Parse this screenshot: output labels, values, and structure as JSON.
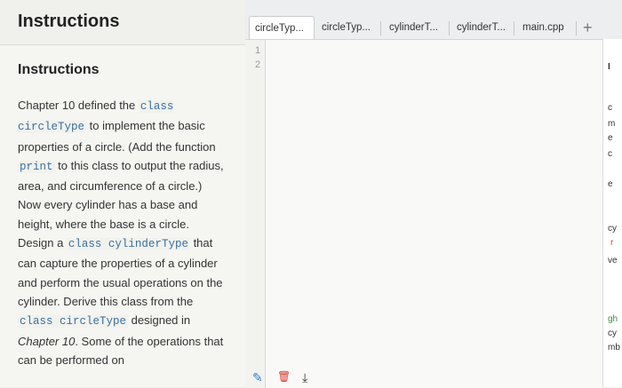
{
  "left": {
    "page_title": "Instructions",
    "section_title": "Instructions",
    "paragraph": [
      {
        "t": "Chapter 10 defined the ",
        "c": false,
        "i": false
      },
      {
        "t": "class circleType",
        "c": true,
        "i": false
      },
      {
        "t": " to implement the basic properties of a circle. (Add the function ",
        "c": false,
        "i": false
      },
      {
        "t": "print",
        "c": true,
        "i": false
      },
      {
        "t": " to this class to output the radius, area, and circumference of a circle.) Now every cylinder has a base and height, where the base is a circle. Design a ",
        "c": false,
        "i": false
      },
      {
        "t": "class cylinderType",
        "c": true,
        "i": false
      },
      {
        "t": " that can capture the properties of a cylinder and perform the usual operations on the cylinder. Derive this class from the ",
        "c": false,
        "i": false
      },
      {
        "t": "class circleType",
        "c": true,
        "i": false
      },
      {
        "t": " designed in ",
        "c": false,
        "i": false
      },
      {
        "t": "Chapter 10",
        "c": false,
        "i": true
      },
      {
        "t": ". Some of the operations that can be performed on",
        "c": false,
        "i": false
      }
    ]
  },
  "tabs": [
    "circleTyp...",
    "circleTyp...",
    "cylinderT...",
    "cylinderT...",
    "main.cpp"
  ],
  "add_tab_label": "+",
  "editor": {
    "line_numbers": [
      "1",
      "2"
    ]
  },
  "right_panel": {
    "fragments": [
      "I",
      "c",
      "m",
      "e",
      "c",
      "e",
      "cy",
      "r",
      "ve",
      "gh",
      "cy",
      "mb"
    ]
  },
  "toolbar": {
    "pencil_icon": "✎",
    "trash_icon": "🗑",
    "download_icon": "⤓"
  },
  "colors": {
    "code_text": "#3a6fa0",
    "pencil": "#2f7fd6",
    "trash": "#d9362f"
  }
}
